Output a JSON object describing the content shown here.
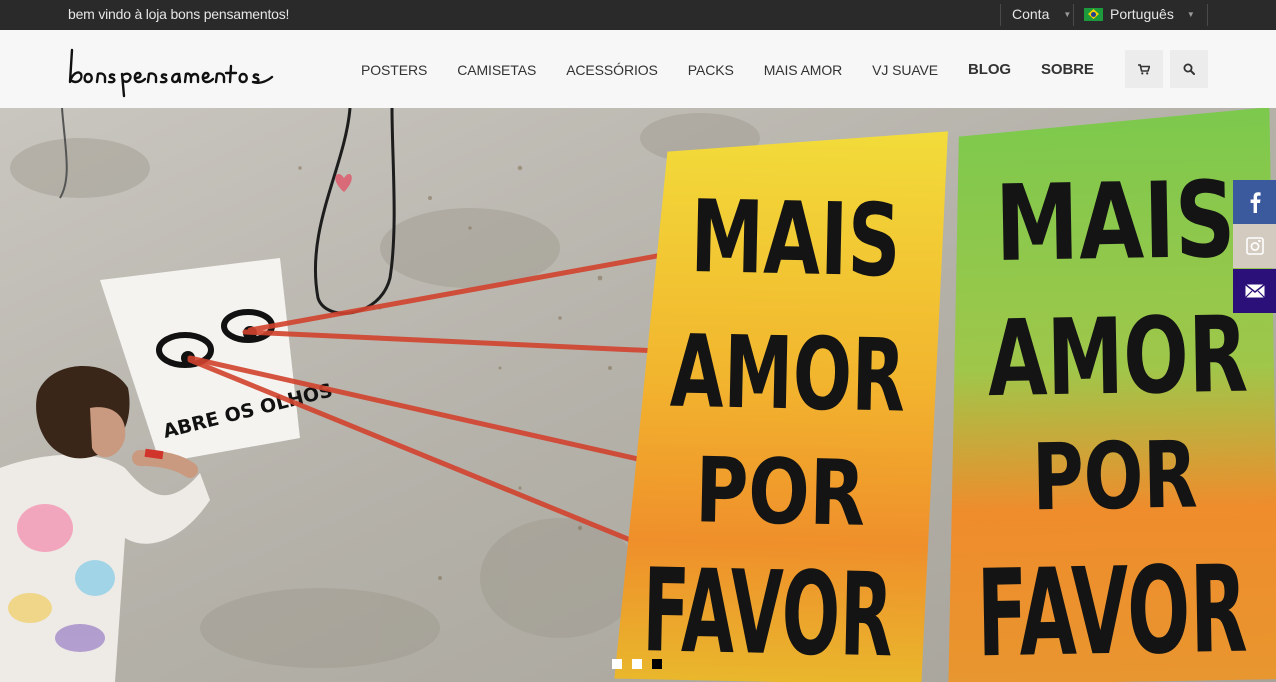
{
  "topbar": {
    "welcome": "bem vindo à loja bons pensamentos!",
    "account_label": "Conta",
    "language_label": "Português"
  },
  "header": {
    "logo_text": "bons pensamentos",
    "nav": [
      {
        "label": "POSTERS"
      },
      {
        "label": "CAMISETAS"
      },
      {
        "label": "ACESSÓRIOS"
      },
      {
        "label": "PACKS"
      },
      {
        "label": "MAIS AMOR"
      },
      {
        "label": "VJ SUAVE"
      },
      {
        "label": "BLOG"
      },
      {
        "label": "SOBRE"
      }
    ],
    "cart_icon": "cart-icon",
    "search_icon": "search-icon"
  },
  "hero": {
    "wall_text": "ABRE OS OLHOS",
    "poster_lines": [
      "MAIS",
      "AMOR",
      "POR",
      "FAVOR"
    ],
    "slides_total": 3,
    "active_slide": 3
  },
  "social": {
    "facebook_icon": "facebook-icon",
    "instagram_icon": "instagram-icon",
    "mail_icon": "mail-icon"
  },
  "colors": {
    "topbar_bg": "#2a2a2a",
    "header_bg": "#f7f7f7",
    "facebook": "#3b5a9d",
    "instagram": "#d4cbc0",
    "mail": "#2a1078"
  }
}
